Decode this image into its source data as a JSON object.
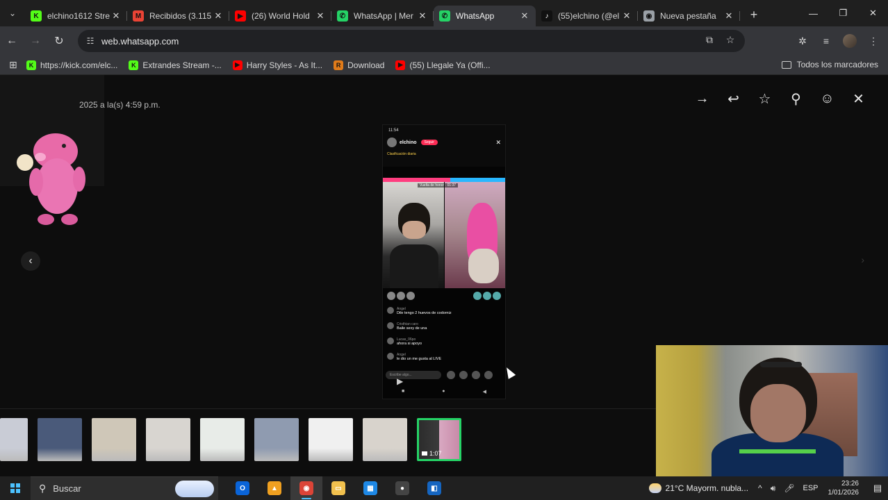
{
  "browser": {
    "tabs": [
      {
        "title": "elchino1612 Stre",
        "favicon": "kick-icon",
        "color": "#53fc18",
        "glyph": "K"
      },
      {
        "title": "Recibidos (3.115",
        "favicon": "gmail-icon",
        "color": "#ea4335",
        "glyph": "M"
      },
      {
        "title": "(26) World Hold",
        "favicon": "youtube-icon",
        "color": "#ff0000",
        "glyph": "▶"
      },
      {
        "title": "WhatsApp | Mer",
        "favicon": "whatsapp-icon",
        "color": "#25d366",
        "glyph": "✆"
      },
      {
        "title": "WhatsApp",
        "favicon": "whatsapp-icon",
        "color": "#25d366",
        "glyph": "✆",
        "active": true
      },
      {
        "title": "(55)elchino (@el",
        "favicon": "tiktok-icon",
        "color": "#111111",
        "glyph": "♪"
      },
      {
        "title": "Nueva pestaña",
        "favicon": "chrome-icon",
        "color": "#9aa0a6",
        "glyph": "◉"
      }
    ],
    "url": "web.whatsapp.com",
    "bookmarks": [
      {
        "label": "https://kick.com/elc...",
        "favicon": "kick-icon",
        "color": "#53fc18",
        "glyph": "K"
      },
      {
        "label": "Extrandes Stream -...",
        "favicon": "kick-icon",
        "color": "#53fc18",
        "glyph": "K"
      },
      {
        "label": "Harry Styles - As It...",
        "favicon": "youtube-icon",
        "color": "#ff0000",
        "glyph": "▶"
      },
      {
        "label": "Download",
        "favicon": "download-site-icon",
        "color": "#e07b1a",
        "glyph": "R"
      },
      {
        "label": "(55) Llegale Ya (Offi...",
        "favicon": "youtube-icon",
        "color": "#ff0000",
        "glyph": "▶"
      }
    ],
    "all_bookmarks_label": "Todos los marcadores"
  },
  "viewer": {
    "sender_info": "2025 a la(s) 4:59 p.m.",
    "media": {
      "status_time": "11:54",
      "streamer_name": "elchino",
      "follow_label": "Seguir",
      "rank_text": "Clasificación diaria",
      "timer_text": "Vuelta de honor · 01:37",
      "chat": [
        {
          "user": "Angel",
          "text": "Dile tengo 2 huevos de codorniz"
        },
        {
          "user": "Cristhian caro",
          "text": "Baile sexy de una"
        },
        {
          "user": "Lucas_06po",
          "text": "ahora si apoyo"
        },
        {
          "user": "Angel",
          "text": "le dio un me gusta al LIVE"
        }
      ],
      "input_placeholder": "Escribe algo..."
    },
    "thumbnails": [
      {
        "kind": "image",
        "color": "#c9ccd6"
      },
      {
        "kind": "image",
        "color": "#4a5a7a"
      },
      {
        "kind": "image",
        "color": "#cfc7b8"
      },
      {
        "kind": "image",
        "color": "#d8d5d0"
      },
      {
        "kind": "image",
        "color": "#e8ece8"
      },
      {
        "kind": "image",
        "color": "#8f9bb0"
      },
      {
        "kind": "image",
        "color": "#f0f0f0"
      },
      {
        "kind": "image",
        "color": "#d8d3cc"
      },
      {
        "kind": "video",
        "duration": "1:07",
        "active": true
      }
    ]
  },
  "taskbar": {
    "search_placeholder": "Buscar",
    "weather": "21°C  Mayorm. nubla...",
    "language": "ESP",
    "time": "23:26",
    "date": "1/01/2026",
    "apps": [
      {
        "name": "outlook-icon",
        "color": "#0a64d8",
        "glyph": "O"
      },
      {
        "name": "app-icon",
        "color": "#f0a020",
        "glyph": "▲"
      },
      {
        "name": "chrome-icon",
        "color": "#db4437",
        "glyph": "◉",
        "active": true
      },
      {
        "name": "file-explorer-icon",
        "color": "#f2c14e",
        "glyph": "▭"
      },
      {
        "name": "store-icon",
        "color": "#1e88e5",
        "glyph": "▦"
      },
      {
        "name": "obs-icon",
        "color": "#444444",
        "glyph": "●"
      },
      {
        "name": "app2-icon",
        "color": "#1565c0",
        "glyph": "◧"
      }
    ]
  }
}
